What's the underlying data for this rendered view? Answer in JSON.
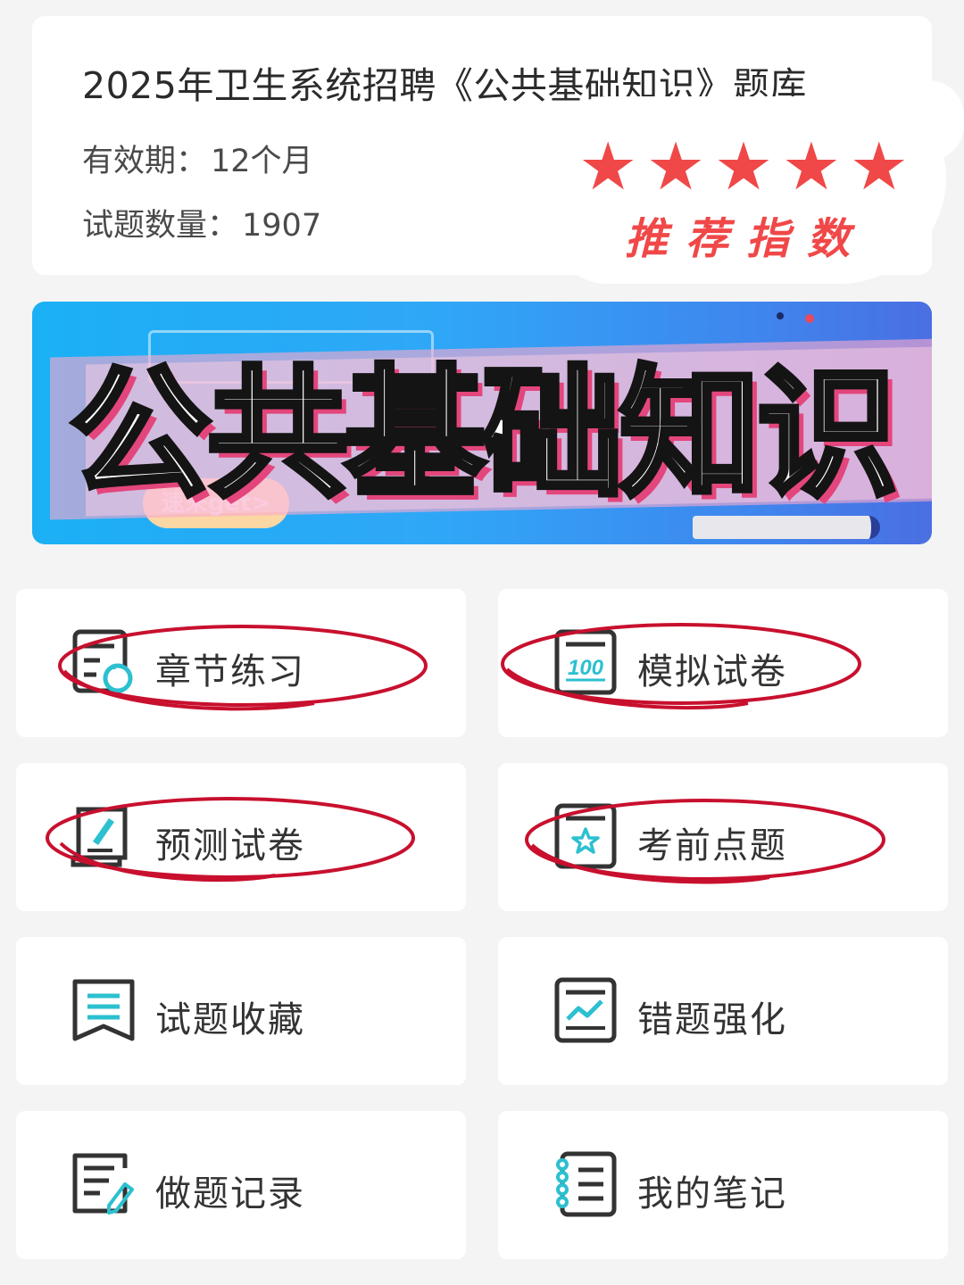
{
  "header": {
    "title": "2025年卫生系统招聘《公共基础知识》题库",
    "validity_label": "有效期：",
    "validity_value": "12个月",
    "count_label": "试题数量：",
    "count_value": "1907"
  },
  "rating": {
    "stars": 5,
    "star_glyph": "★",
    "label": "推荐指数",
    "color": "#f04848"
  },
  "banner": {
    "headline": "公共基础知识",
    "button_text": "速来get>"
  },
  "menu": [
    {
      "label": "章节练习",
      "icon": "chapter-practice-icon",
      "circled": true
    },
    {
      "label": "模拟试卷",
      "icon": "mock-exam-100-icon",
      "circled": true
    },
    {
      "label": "预测试卷",
      "icon": "forecast-paper-icon",
      "circled": true
    },
    {
      "label": "考前点题",
      "icon": "key-points-star-icon",
      "circled": true
    },
    {
      "label": "试题收藏",
      "icon": "bookmark-icon",
      "circled": false
    },
    {
      "label": "错题强化",
      "icon": "wrong-question-chart-icon",
      "circled": false
    },
    {
      "label": "做题记录",
      "icon": "record-edit-icon",
      "circled": false
    },
    {
      "label": "我的笔记",
      "icon": "notebook-icon",
      "circled": false
    }
  ],
  "colors": {
    "accent_teal": "#2cc0d0",
    "icon_dark": "#333333",
    "circle_red": "#c8102e"
  }
}
